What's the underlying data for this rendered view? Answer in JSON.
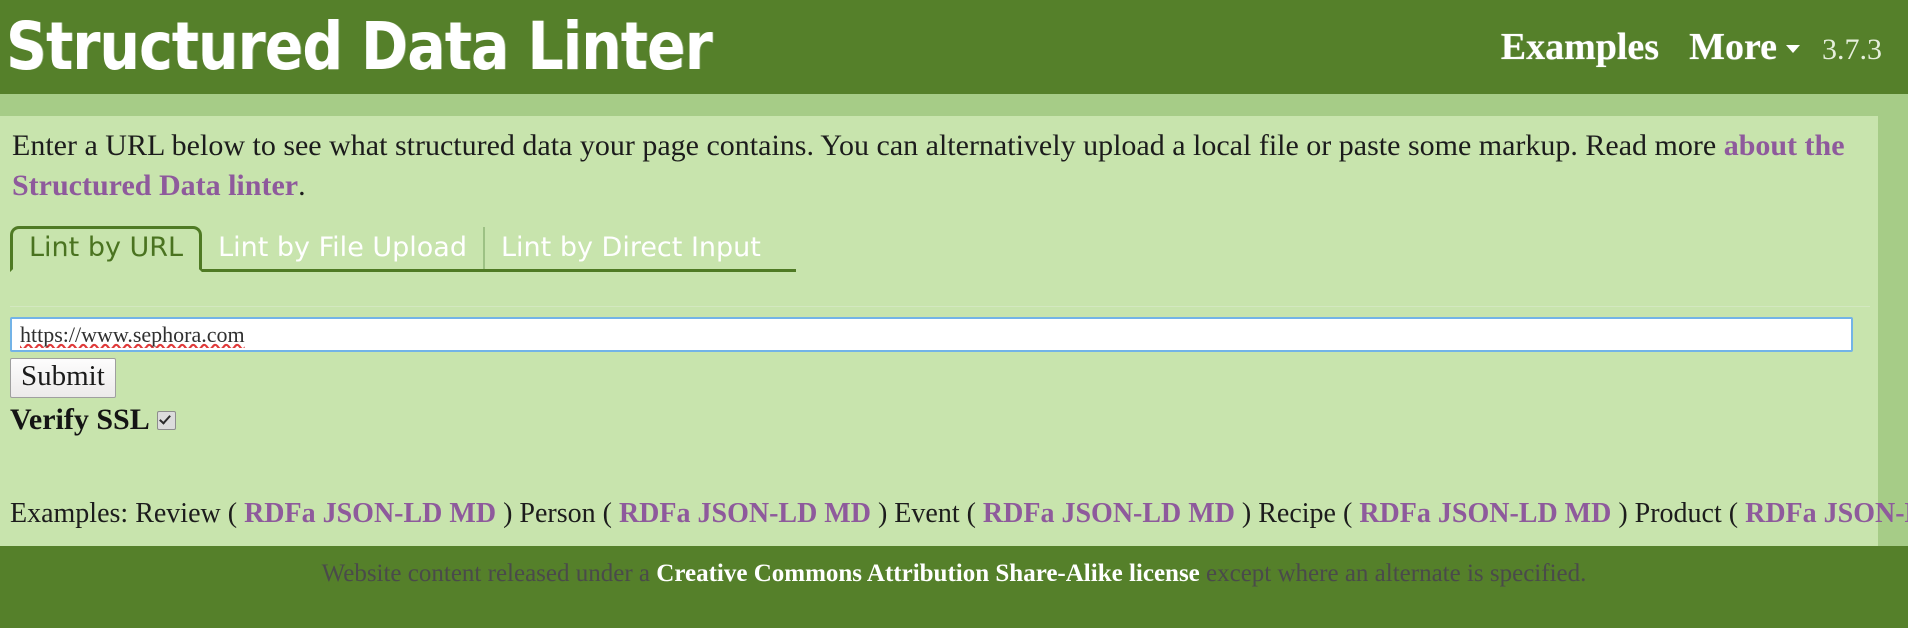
{
  "header": {
    "title": "Structured Data Linter",
    "nav": {
      "examples_label": "Examples",
      "more_label": "More",
      "version": "3.7.3"
    },
    "background_color": "#55802a"
  },
  "intro": {
    "text_before": "Enter a URL below to see what structured data your page contains. You can alternatively upload a local file or paste some markup. Read more ",
    "link_label": "about the Structured Data linter",
    "text_after": ".",
    "link_color": "#8e5a9c"
  },
  "tabs": [
    {
      "label": "Lint by URL",
      "active": true
    },
    {
      "label": "Lint by File Upload",
      "active": false
    },
    {
      "label": "Lint by Direct Input",
      "active": false
    }
  ],
  "form": {
    "url_value": "https://www.sephora.com",
    "url_placeholder": "",
    "submit_label": "Submit",
    "verify_ssl_label": "Verify SSL",
    "verify_ssl_checked": true
  },
  "examples": {
    "prefix": "Examples:",
    "open_paren": "(",
    "close_paren": ")",
    "formats": {
      "rdfa": "RDFa",
      "jsonld": "JSON-LD",
      "md": "MD"
    },
    "items": [
      {
        "name": "Review"
      },
      {
        "name": "Person"
      },
      {
        "name": "Event"
      },
      {
        "name": "Recipe"
      },
      {
        "name": "Product"
      }
    ]
  },
  "footer": {
    "text_before": "Website content released under a ",
    "link_label": "Creative Commons Attribution Share-Alike license",
    "text_after": " except where an alternate is specified."
  }
}
